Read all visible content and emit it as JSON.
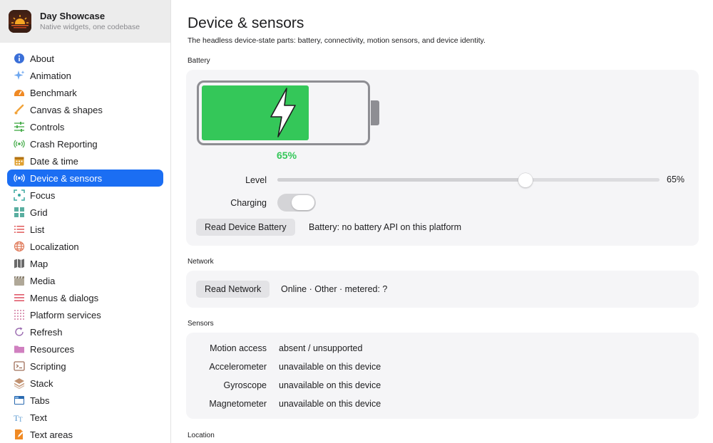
{
  "app": {
    "name": "Day Showcase",
    "subtitle": "Native widgets, one codebase"
  },
  "sidebar": {
    "items": [
      {
        "label": "About",
        "icon": "info-icon",
        "color": "#3a6fd8"
      },
      {
        "label": "Animation",
        "icon": "sparkles-icon",
        "color": "#6fa8f0"
      },
      {
        "label": "Benchmark",
        "icon": "gauge-icon",
        "color": "#f08a24"
      },
      {
        "label": "Canvas & shapes",
        "icon": "brush-icon",
        "color": "#f2a33a"
      },
      {
        "label": "Controls",
        "icon": "sliders-icon",
        "color": "#4caf50"
      },
      {
        "label": "Crash Reporting",
        "icon": "broadcast-icon",
        "color": "#4caf50"
      },
      {
        "label": "Date & time",
        "icon": "calendar-icon",
        "color": "#e0a030"
      },
      {
        "label": "Device & sensors",
        "icon": "broadcast-icon",
        "color": "#ffffff",
        "active": true
      },
      {
        "label": "Focus",
        "icon": "focus-icon",
        "color": "#3aa8a0"
      },
      {
        "label": "Grid",
        "icon": "grid-icon",
        "color": "#5aaea0"
      },
      {
        "label": "List",
        "icon": "list-icon",
        "color": "#e05a5a"
      },
      {
        "label": "Localization",
        "icon": "globe-icon",
        "color": "#e07a5a"
      },
      {
        "label": "Map",
        "icon": "map-icon",
        "color": "#6a6a6a"
      },
      {
        "label": "Media",
        "icon": "clapper-icon",
        "color": "#b0a898"
      },
      {
        "label": "Menus & dialogs",
        "icon": "menu-icon",
        "color": "#e05a6a"
      },
      {
        "label": "Platform services",
        "icon": "dots-grid-icon",
        "color": "#d07aa0"
      },
      {
        "label": "Refresh",
        "icon": "refresh-icon",
        "color": "#9a6ab0"
      },
      {
        "label": "Resources",
        "icon": "folder-icon",
        "color": "#d080c0"
      },
      {
        "label": "Scripting",
        "icon": "terminal-icon",
        "color": "#a0705a"
      },
      {
        "label": "Stack",
        "icon": "stack-icon",
        "color": "#c09070"
      },
      {
        "label": "Tabs",
        "icon": "tabs-icon",
        "color": "#2a6ab0"
      },
      {
        "label": "Text",
        "icon": "text-icon",
        "color": "#5a9ad0"
      },
      {
        "label": "Text areas",
        "icon": "doc-edit-icon",
        "color": "#f08a24"
      }
    ]
  },
  "page": {
    "title": "Device & sensors",
    "description": "The headless device-state parts: battery, connectivity, motion sensors, and device identity."
  },
  "battery": {
    "section_label": "Battery",
    "level_fraction": 0.65,
    "percent_label": "65%",
    "fill_color": "#34c759",
    "level_label": "Level",
    "level_value": "65%",
    "charging_label": "Charging",
    "charging_on": false,
    "read_button": "Read Device Battery",
    "status": "Battery: no battery API on this platform"
  },
  "network": {
    "section_label": "Network",
    "read_button": "Read Network",
    "status": "Online · Other · metered: ?"
  },
  "sensors": {
    "section_label": "Sensors",
    "rows": [
      {
        "label": "Motion access",
        "value": "absent / unsupported"
      },
      {
        "label": "Accelerometer",
        "value": "unavailable on this device"
      },
      {
        "label": "Gyroscope",
        "value": "unavailable on this device"
      },
      {
        "label": "Magnetometer",
        "value": "unavailable on this device"
      }
    ]
  },
  "location": {
    "section_label": "Location"
  }
}
